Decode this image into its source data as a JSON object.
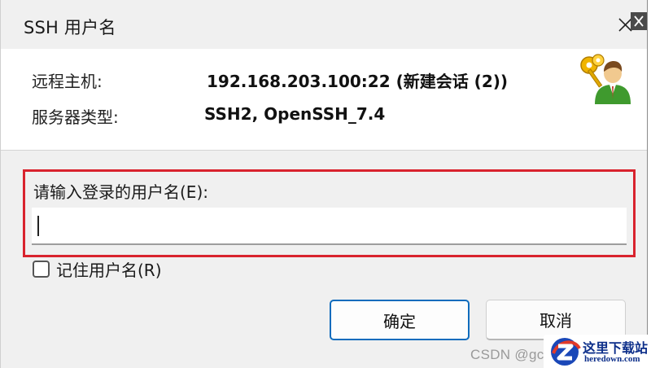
{
  "window": {
    "title": "SSH 用户名",
    "close_icon": "close-icon"
  },
  "info": {
    "host_label": "远程主机:",
    "host_value": "192.168.203.100:22 (新建会话 (2))",
    "server_type_label": "服务器类型:",
    "server_type_value": "SSH2, OpenSSH_7.4",
    "icon": "key-user-icon"
  },
  "form": {
    "username_label": "请输入登录的用户名(E):",
    "username_value": "",
    "highlight_color": "#d9232e"
  },
  "remember": {
    "label": "记住用户名(R)",
    "checked": false
  },
  "buttons": {
    "ok_label": "确定",
    "cancel_label": "取消"
  },
  "watermarks": {
    "csdn": "CSDN @gc",
    "site_name": "这里下载站",
    "site_url": "heredown.com"
  },
  "colors": {
    "accent": "#0f6cbd",
    "highlight": "#d9232e",
    "watermark_text": "#0d2f8a"
  }
}
